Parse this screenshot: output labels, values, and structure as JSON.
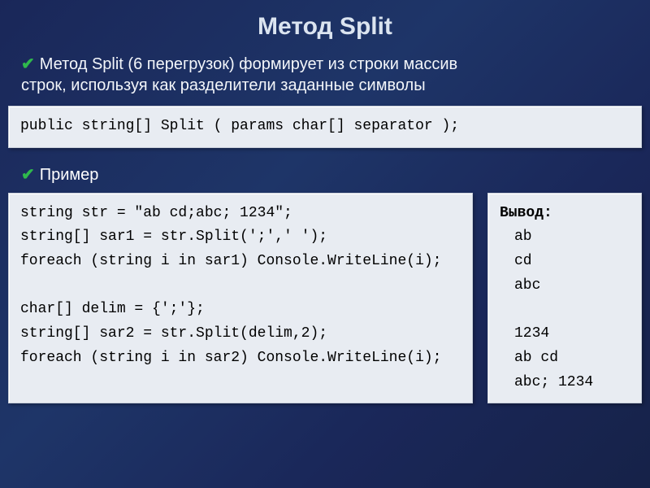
{
  "title": "Метод Split",
  "desc_line1": "Метод  Split  (6 перегрузок)  формирует из строки массив",
  "desc_line2": "строк, используя как разделители заданные символы",
  "signature": "public string[] Split ( params char[] separator );",
  "example_label": "Пример",
  "code": {
    "l1": "string str = \"ab cd;abc; 1234\";",
    "l2": "string[] sar1 = str.Split(';',' ');",
    "l3": "foreach (string i in sar1) Console.WriteLine(i);",
    "l4": "",
    "l5": "char[] delim = {';'};",
    "l6": "string[] sar2 = str.Split(delim,2);",
    "l7": "foreach (string i in sar2) Console.WriteLine(i);"
  },
  "output": {
    "title": "Вывод:",
    "l1": "ab",
    "l2": "cd",
    "l3": "abc",
    "l4": "",
    "l5": "1234",
    "l6": "ab cd",
    "l7": "abc; 1234"
  },
  "check": "✔"
}
